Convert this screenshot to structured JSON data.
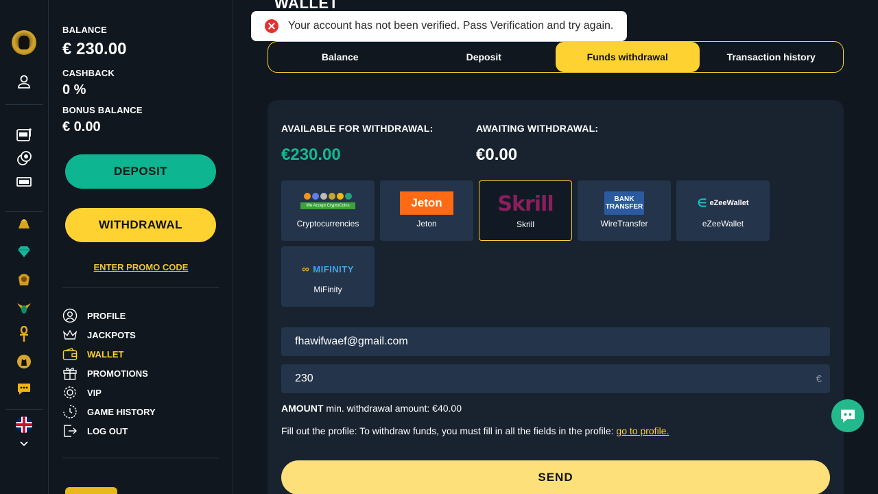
{
  "balance": {
    "balance_label": "BALANCE",
    "balance_value": "€ 230.00",
    "cashback_label": "CASHBACK",
    "cashback_value": "0 %",
    "bonus_label": "BONUS BALANCE",
    "bonus_value": "€ 0.00"
  },
  "actions": {
    "deposit": "DEPOSIT",
    "withdrawal": "WITHDRAWAL",
    "promo": "ENTER PROMO CODE"
  },
  "menu": [
    {
      "label": "PROFILE",
      "icon": "user-circle-icon"
    },
    {
      "label": "JACKPOTS",
      "icon": "crown-icon"
    },
    {
      "label": "WALLET",
      "icon": "wallet-icon",
      "active": true
    },
    {
      "label": "PROMOTIONS",
      "icon": "gift-icon"
    },
    {
      "label": "VIP",
      "icon": "vip-wreath-icon"
    },
    {
      "label": "GAME HISTORY",
      "icon": "history-icon"
    },
    {
      "label": "LOG OUT",
      "icon": "logout-icon"
    }
  ],
  "page": {
    "title": "WALLET"
  },
  "toast": {
    "message": "Your account has not been verified. Pass Verification and try again."
  },
  "tabs": [
    {
      "label": "Balance"
    },
    {
      "label": "Deposit"
    },
    {
      "label": "Funds withdrawal",
      "active": true
    },
    {
      "label": "Transaction history"
    }
  ],
  "withdrawal": {
    "available_label": "AVAILABLE FOR WITHDRAWAL:",
    "available_value": "€230.00",
    "awaiting_label": "AWAITING WITHDRAWAL:",
    "awaiting_value": "€0.00",
    "methods": [
      {
        "name": "Cryptocurrencies",
        "logo_text": "We Accept CryptoCoins"
      },
      {
        "name": "Jeton",
        "logo_text": "Jeton"
      },
      {
        "name": "Skrill",
        "logo_text": "Skrill",
        "selected": true
      },
      {
        "name": "WireTransfer",
        "logo_text": "BANK TRANSFER"
      },
      {
        "name": "eZeeWallet",
        "logo_text": "eZeeWallet"
      },
      {
        "name": "MiFinity",
        "logo_text": "MIFINITY"
      }
    ],
    "email_value": "fhawifwaef@gmail.com",
    "amount_value": "230",
    "currency_symbol": "€",
    "amount_label": "AMOUNT",
    "amount_hint": " min. withdrawal amount: €40.00",
    "note_text": "Fill out the profile: To withdraw funds, you must fill in all the fields in the profile: ",
    "note_link": "go to profile.",
    "send_label": "SEND"
  },
  "colors": {
    "accent_yellow": "#fdd231",
    "accent_green": "#0db590",
    "background": "#10171e",
    "card": "#18232f"
  }
}
